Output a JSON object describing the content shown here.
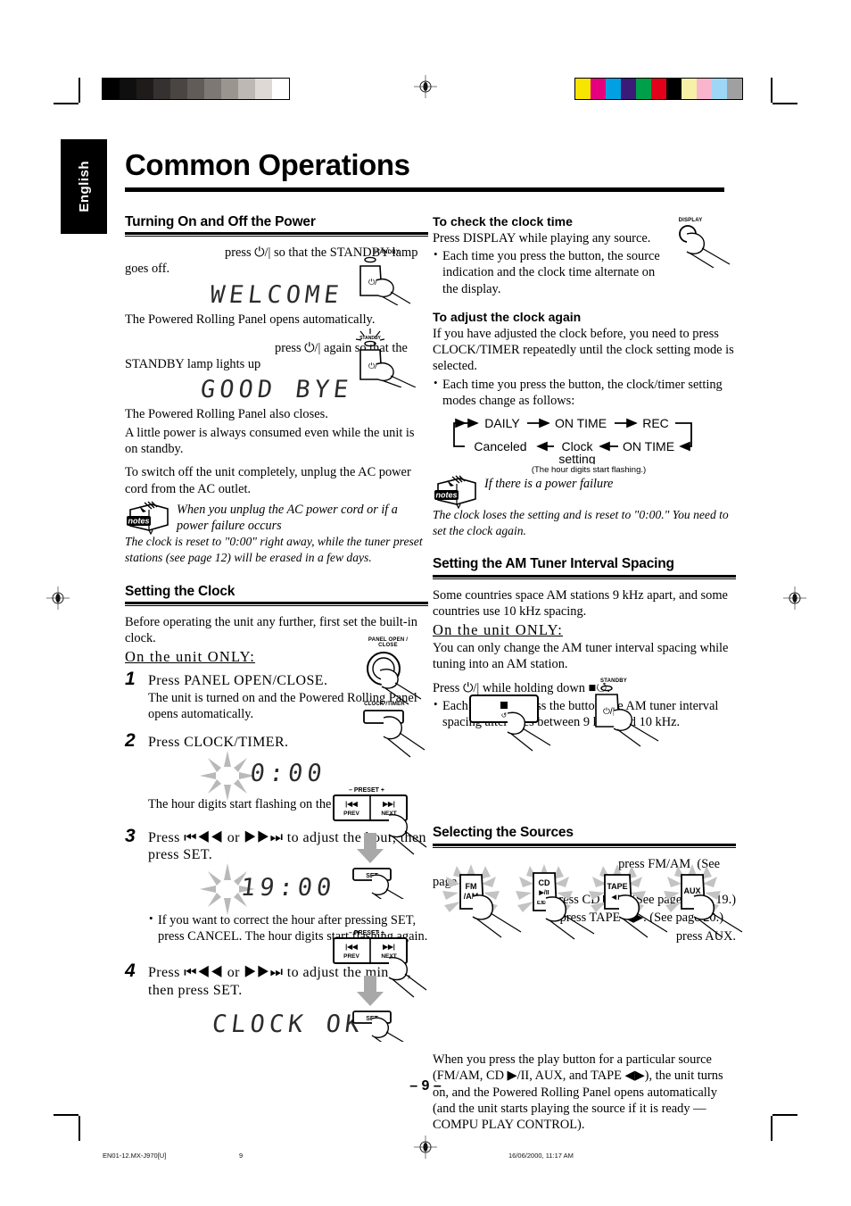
{
  "document": {
    "language_tab": "English",
    "title": "Common Operations",
    "page_number": "– 9 –",
    "footer": {
      "file": "EN01-12.MX-J970[U]",
      "page": "9",
      "timestamp": "16/06/2000, 11:17 AM"
    }
  },
  "calibration": {
    "gray_steps": [
      "#000000",
      "#100f0f",
      "#1e1b1a",
      "#353130",
      "#4a4542",
      "#625c58",
      "#7d7874",
      "#9b9590",
      "#bdb8b3",
      "#ded9d4",
      "#ffffff"
    ],
    "color_patches": [
      "#f7e400",
      "#e6007e",
      "#00a0e3",
      "#3c1a78",
      "#00a04a",
      "#e2001a",
      "#000000",
      "#f7f0a8",
      "#f9b5cd",
      "#9ed6f5",
      "#a0a0a0"
    ]
  },
  "left_column": {
    "section1": {
      "heading": "Turning On and Off the Power",
      "p1": "press ⏻/| so that the STANDBY lamp goes off.",
      "display1": "WELCOME",
      "p2": "The Powered Rolling Panel opens automatically.",
      "p3": "press ⏻/| again so that the STANDBY lamp lights up",
      "display2": "GOOD BYE",
      "p4": "The Powered Rolling Panel also closes.",
      "p5": "A little power is always consumed even while the unit is on standby.",
      "p6": "To switch off the unit completely, unplug the AC power cord from the AC outlet.",
      "note_title": "When you unplug the AC power cord or if a power failure occurs",
      "note_body": "The clock is reset to \"0:00\" right away, while the tuner preset stations (see page 12) will be erased in a few days.",
      "illustration_labels": {
        "standby": "STANDBY",
        "power_button": "⏻/|"
      }
    },
    "section2": {
      "heading": "Setting the Clock",
      "intro": "Before operating the unit any further, first set the built-in clock.",
      "only": "On the unit ONLY:",
      "steps": [
        {
          "num": "1",
          "head": "Press PANEL OPEN/CLOSE.",
          "body": "The unit is turned on and the Powered Rolling Panel opens automatically.",
          "button_label": "PANEL OPEN / CLOSE"
        },
        {
          "num": "2",
          "head": "Press CLOCK/TIMER.",
          "display": "0:00",
          "body": "The hour digits start flashing on the display.",
          "button_label": "CLOCK /TIMER"
        },
        {
          "num": "3",
          "head": "Press ⏮◀◀ or ▶▶⏭ to adjust the hour, then press SET.",
          "display": "19:00",
          "bullet": "If you want to correct the hour after pressing SET, press CANCEL. The hour digits start flashing again.",
          "preset_label": "– PRESET +",
          "prev_label": "PREV",
          "next_label": "NEXT",
          "set_label": "SET"
        },
        {
          "num": "4",
          "head": "Press ⏮◀◀ or ▶▶⏭ to adjust the minute, then press SET.",
          "display": "CLOCK OK",
          "preset_label": "– PRESET +",
          "prev_label": "PREV",
          "next_label": "NEXT",
          "set_label": "SET"
        }
      ]
    }
  },
  "right_column": {
    "check_clock": {
      "heading": "To check the clock time",
      "p1": "Press DISPLAY while playing any source.",
      "bullet1": "Each time you press the button, the source indication and the clock time alternate on the display.",
      "button_label": "DISPLAY"
    },
    "adjust_clock": {
      "heading": "To adjust the clock again",
      "p1": "If you have adjusted the clock before, you need to press CLOCK/TIMER repeatedly until the clock setting mode is selected.",
      "bullet1": "Each time you press the button, the clock/timer setting modes change as follows:",
      "flow_top": [
        "DAILY",
        "ON TIME",
        "REC"
      ],
      "flow_bottom": [
        "Canceled",
        "Clock setting",
        "ON TIME"
      ],
      "flow_note": "(The hour digits start flashing.)",
      "note_title": "If there is a power failure",
      "note_body": "The clock loses the setting and is reset to \"0:00.\" You need to set the clock again."
    },
    "am_spacing": {
      "heading": "Setting the AM Tuner Interval Spacing",
      "p1": "Some countries space AM stations 9 kHz apart, and some countries use 10 kHz spacing.",
      "only": "On the unit ONLY:",
      "p2": "You can only change the AM tuner interval spacing while tuning into an AM station.",
      "p3": "Press ⏻/| while holding down ■↺.",
      "bullet1": "Each time you press the button, the AM tuner interval spacing alternates between 9 kHz and 10 kHz.",
      "illustration_labels": {
        "stop_button": "■",
        "standby": "STANDBY",
        "power_button": "⏻/|"
      }
    },
    "sources": {
      "heading": "Selecting the Sources",
      "line1": "press FM/AM. (See",
      "line2": "page 12.)",
      "line3": "press CD ▶/II. (See pages 13 – 19.)",
      "line4": "press TAPE ◀▶. (See page 20.)",
      "line5": "press AUX.",
      "buttons": [
        {
          "top": "FM",
          "mid": "/AM",
          "sub": ""
        },
        {
          "top": "CD",
          "mid": "▶/II",
          "sub": "EJECT"
        },
        {
          "top": "TAPE",
          "mid": "◀ ▶",
          "sub": ""
        },
        {
          "top": "AUX",
          "mid": "",
          "sub": ""
        }
      ],
      "closing": "When you press the play button for a particular source (FM/AM, CD ▶/II, AUX, and TAPE ◀▶), the unit turns on, and the Powered Rolling Panel opens automatically (and the unit starts playing the source if it is ready — COMPU PLAY CONTROL)."
    }
  }
}
